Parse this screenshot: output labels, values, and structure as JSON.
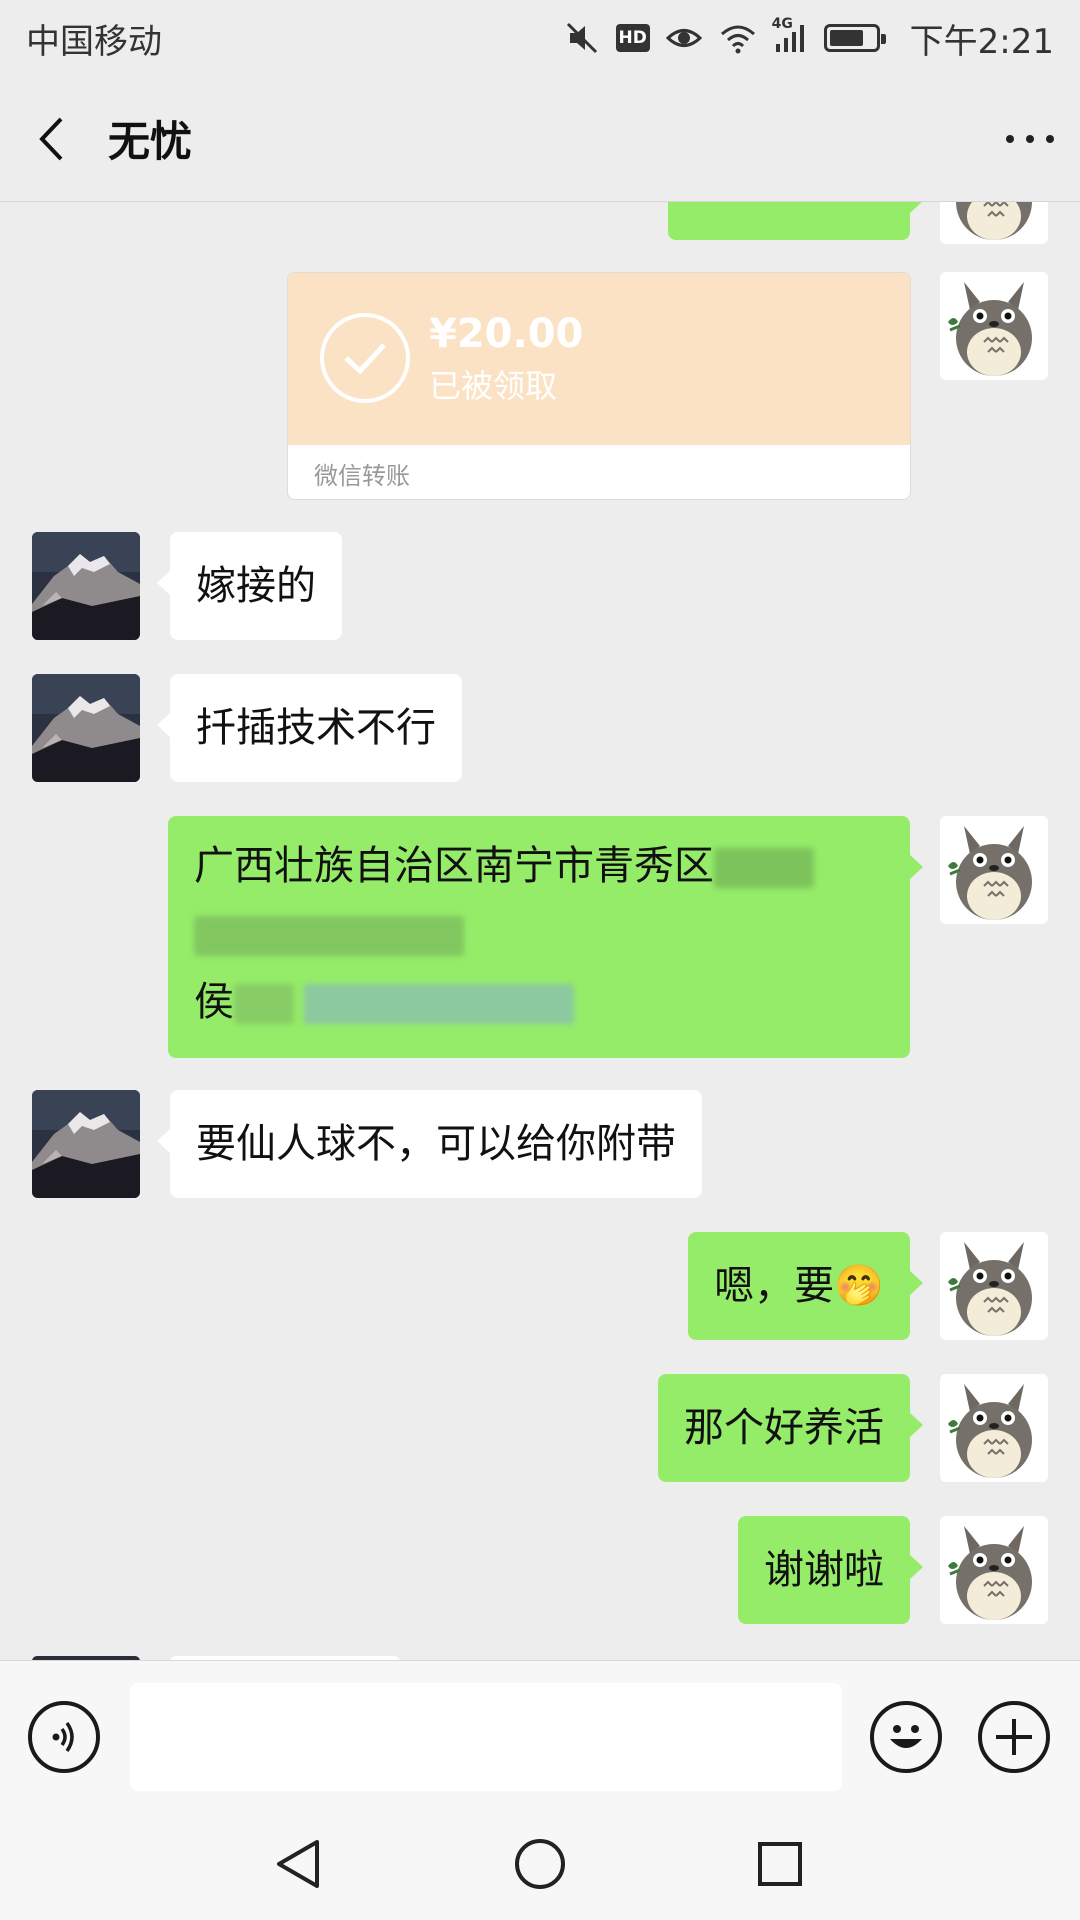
{
  "status_bar": {
    "carrier": "中国移动",
    "hd_label": "HD",
    "network": "4G",
    "time": "下午2:21",
    "battery_level": 0.75,
    "icons": [
      "mute-icon",
      "hd-icon",
      "eye-icon",
      "wifi-icon",
      "signal-icon",
      "battery-icon"
    ]
  },
  "header": {
    "title": "无忧",
    "back_icon": "chevron-left-icon",
    "more_icon": "more-dots-icon"
  },
  "messages": [
    {
      "id": "m0",
      "from": "self",
      "type": "text",
      "text": "…",
      "partially_visible": true
    },
    {
      "id": "m1",
      "from": "self",
      "type": "transfer",
      "amount": "¥20.00",
      "status": "已被领取",
      "caption": "微信转账"
    },
    {
      "id": "m2",
      "from": "other",
      "type": "text",
      "text": "嫁接的"
    },
    {
      "id": "m3",
      "from": "other",
      "type": "text",
      "text": "扦插技术不行"
    },
    {
      "id": "m4",
      "from": "self",
      "type": "text",
      "line1": "广西壮族自治区南宁市青秀区",
      "line3_prefix": "侯",
      "has_redaction": true
    },
    {
      "id": "m5",
      "from": "other",
      "type": "text",
      "text": "要仙人球不，可以给你附带"
    },
    {
      "id": "m6",
      "from": "self",
      "type": "text",
      "text": "嗯，要",
      "emoji": "🤭"
    },
    {
      "id": "m7",
      "from": "self",
      "type": "text",
      "text": "那个好养活"
    },
    {
      "id": "m8",
      "from": "self",
      "type": "text",
      "text": "谢谢啦"
    }
  ],
  "input_bar": {
    "voice_icon": "voice-icon",
    "emoji_icon": "emoji-icon",
    "plus_icon": "plus-icon",
    "text_value": ""
  },
  "system_nav": {
    "back_icon": "nav-back-triangle-icon",
    "home_icon": "nav-home-circle-icon",
    "recent_icon": "nav-recent-square-icon"
  },
  "colors": {
    "background": "#ededed",
    "self_bubble": "#95ec69",
    "other_bubble": "#ffffff",
    "transfer_card": "#fce2c4"
  }
}
